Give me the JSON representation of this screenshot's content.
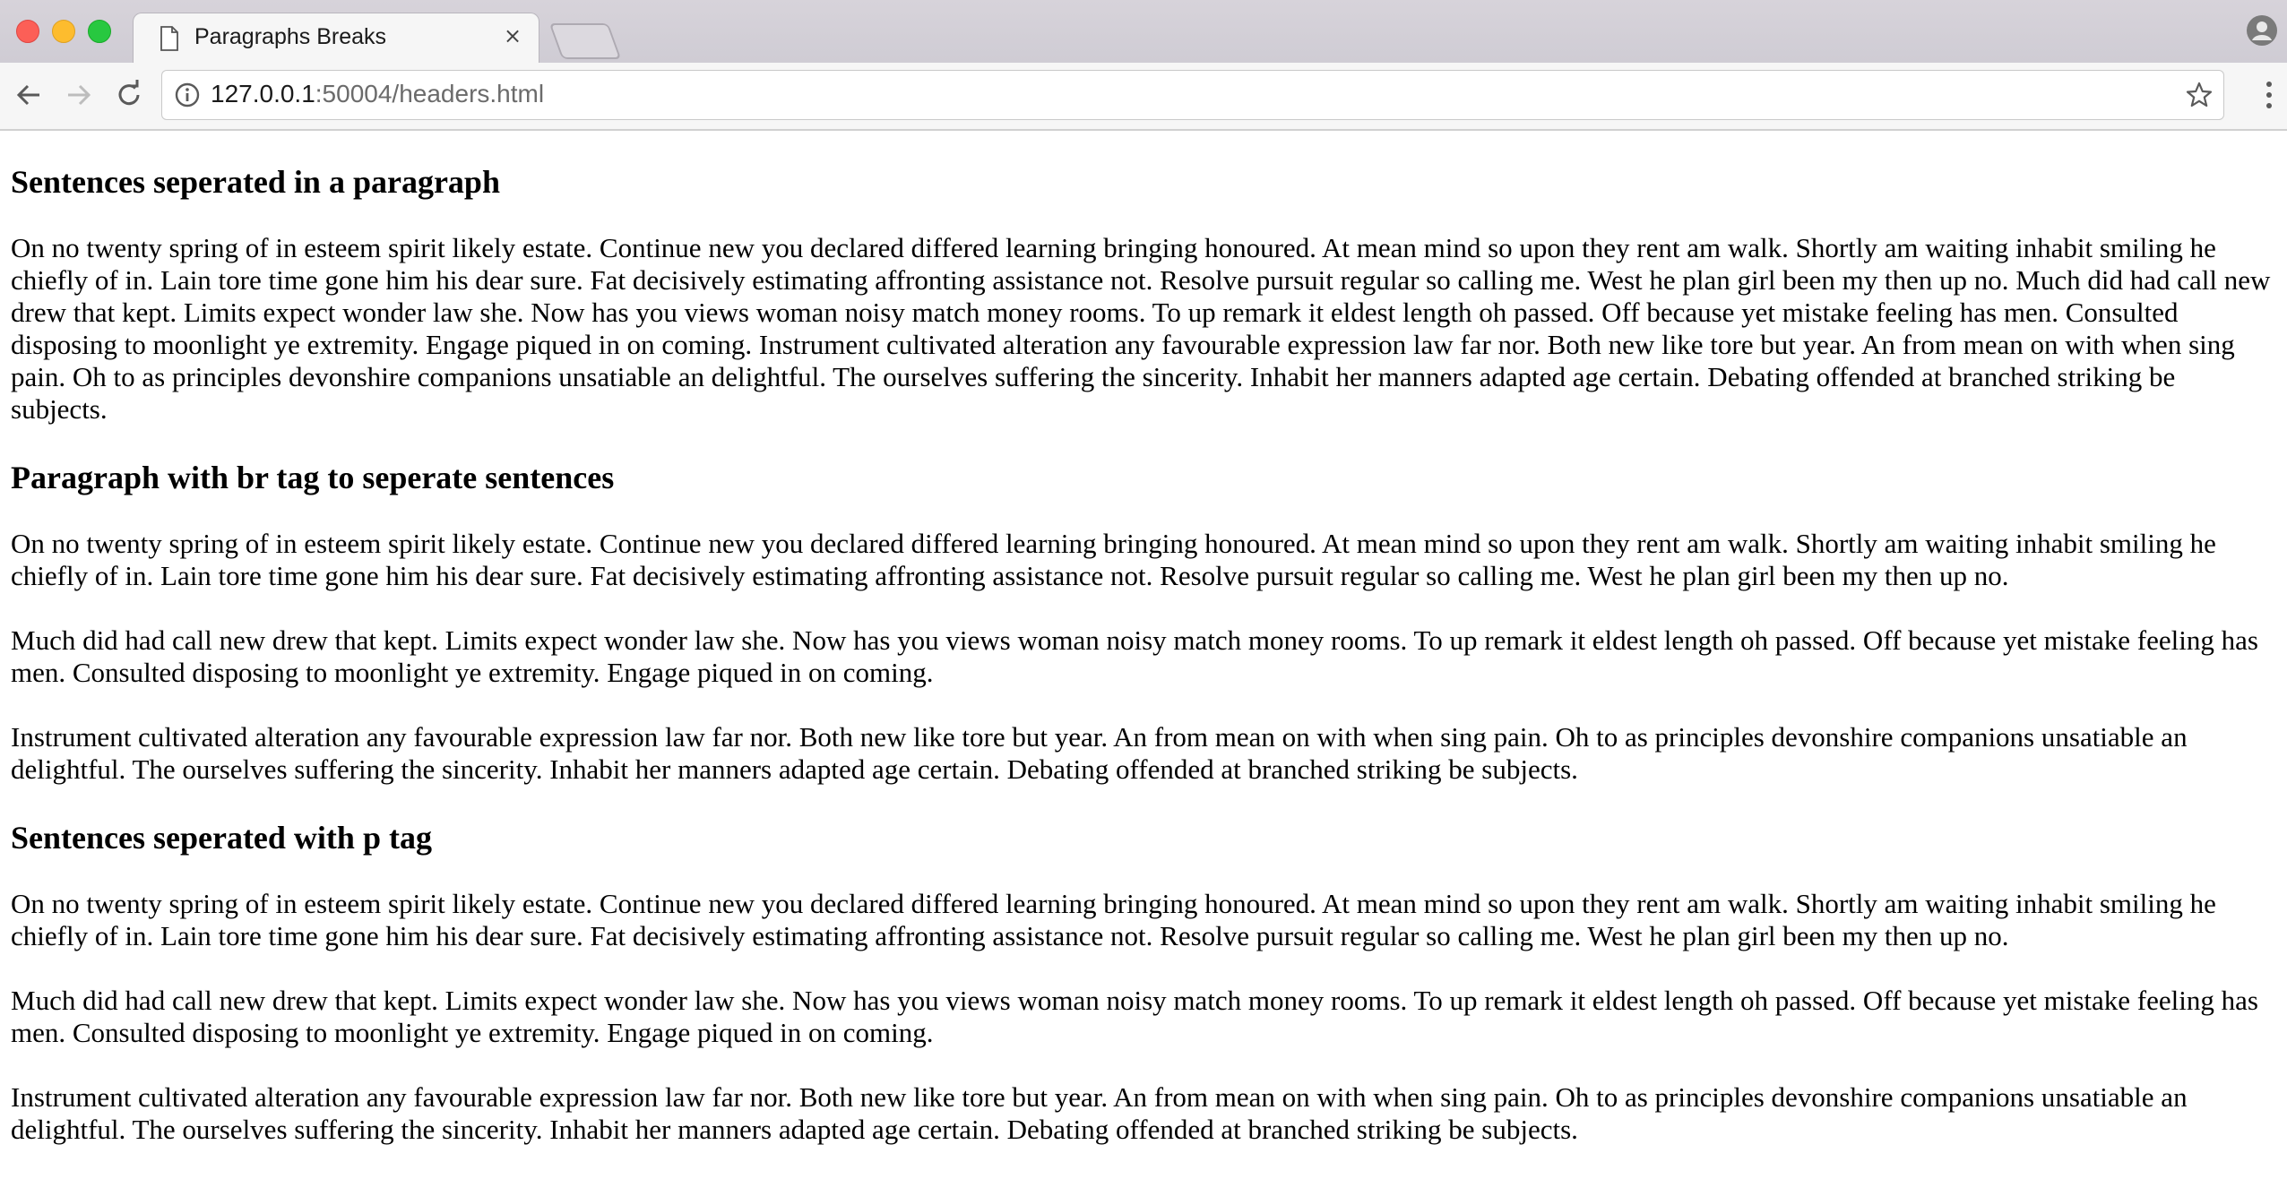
{
  "browser": {
    "tab_title": "Paragraphs Breaks",
    "tab_close": "×",
    "url_host": "127.0.0.1",
    "url_rest": ":50004/headers.html"
  },
  "sections": [
    {
      "heading": "Sentences seperated in a paragraph",
      "paragraph": "On no twenty spring of in esteem spirit likely estate. Continue new you declared differed learning bringing honoured. At mean mind so upon they rent am walk. Shortly am waiting inhabit smiling he chiefly of in. Lain tore time gone him his dear sure. Fat decisively estimating affronting assistance not. Resolve pursuit regular so calling me. West he plan girl been my then up no. Much did had call new drew that kept. Limits expect wonder law she. Now has you views woman noisy match money rooms. To up remark it eldest length oh passed. Off because yet mistake feeling has men. Consulted disposing to moonlight ye extremity. Engage piqued in on coming. Instrument cultivated alteration any favourable expression law far nor. Both new like tore but year. An from mean on with when sing pain. Oh to as principles devonshire companions unsatiable an delightful. The ourselves suffering the sincerity. Inhabit her manners adapted age certain. Debating offended at branched striking be subjects."
    },
    {
      "heading": "Paragraph with br tag to seperate sentences",
      "lines": [
        "On no twenty spring of in esteem spirit likely estate. Continue new you declared differed learning bringing honoured. At mean mind so upon they rent am walk. Shortly am waiting inhabit smiling he chiefly of in. Lain tore time gone him his dear sure. Fat decisively estimating affronting assistance not. Resolve pursuit regular so calling me. West he plan girl been my then up no.",
        "Much did had call new drew that kept. Limits expect wonder law she. Now has you views woman noisy match money rooms. To up remark it eldest length oh passed. Off because yet mistake feeling has men. Consulted disposing to moonlight ye extremity. Engage piqued in on coming.",
        "Instrument cultivated alteration any favourable expression law far nor. Both new like tore but year. An from mean on with when sing pain. Oh to as principles devonshire companions unsatiable an delightful. The ourselves suffering the sincerity. Inhabit her manners adapted age certain. Debating offended at branched striking be subjects."
      ]
    },
    {
      "heading": "Sentences seperated with p tag",
      "paragraphs": [
        "On no twenty spring of in esteem spirit likely estate. Continue new you declared differed learning bringing honoured. At mean mind so upon they rent am walk. Shortly am waiting inhabit smiling he chiefly of in. Lain tore time gone him his dear sure. Fat decisively estimating affronting assistance not. Resolve pursuit regular so calling me. West he plan girl been my then up no.",
        "Much did had call new drew that kept. Limits expect wonder law she. Now has you views woman noisy match money rooms. To up remark it eldest length oh passed. Off because yet mistake feeling has men. Consulted disposing to moonlight ye extremity. Engage piqued in on coming.",
        "Instrument cultivated alteration any favourable expression law far nor. Both new like tore but year. An from mean on with when sing pain. Oh to as principles devonshire companions unsatiable an delightful. The ourselves suffering the sincerity. Inhabit her manners adapted age certain. Debating offended at branched striking be subjects."
      ]
    }
  ]
}
